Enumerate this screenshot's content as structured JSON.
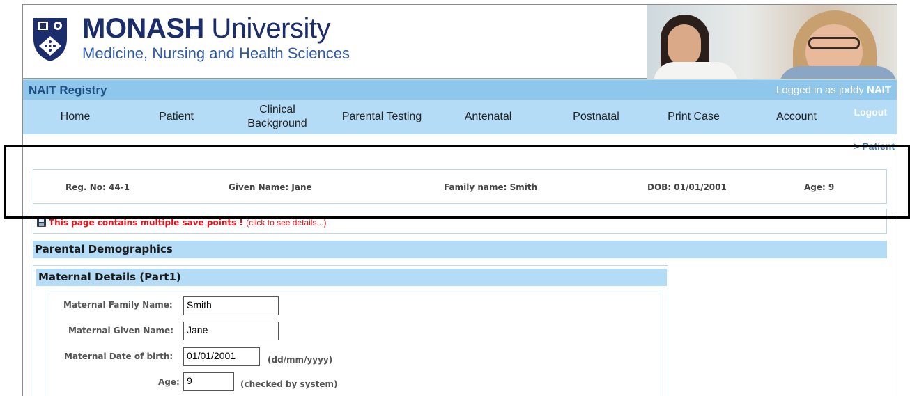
{
  "header": {
    "org_name_bold": "MONASH",
    "org_name_rest": " University",
    "faculty": "Medicine, Nursing and Health Sciences"
  },
  "registry": {
    "title": "NAIT Registry",
    "login_prefix": "Logged in as joddy ",
    "login_user": "NAIT"
  },
  "nav": {
    "home": "Home",
    "patient": "Patient",
    "clinical_line1": "Clinical",
    "clinical_line2": "Background",
    "parental_testing": "Parental Testing",
    "antenatal": "Antenatal",
    "postnatal": "Postnatal",
    "print_case": "Print Case",
    "account": "Account",
    "logout": "Logout"
  },
  "breadcrumb": "> Patient",
  "patient_info": {
    "reg_no": "Reg. No: 44-1",
    "given_name": "Given Name: Jane",
    "family_name": "Family name: Smith",
    "dob": "DOB: 01/01/2001",
    "age": "Age: 9"
  },
  "save_notice": {
    "message": "This page contains multiple save points ! ",
    "link": "(click to see details...)"
  },
  "section_title": "Parental Demographics",
  "maternal": {
    "heading": "Maternal Details (Part1)",
    "family_name_label": "Maternal Family Name:",
    "family_name_value": "Smith",
    "given_name_label": "Maternal Given Name:",
    "given_name_value": "Jane",
    "dob_label": "Maternal Date of birth:",
    "dob_value": "01/01/2001",
    "dob_hint": "(dd/mm/yyyy)",
    "age_label": "Age:",
    "age_value": "9",
    "age_hint": "(checked by system)"
  },
  "colors": {
    "nav_bg": "#b4dcf6",
    "registry_bar": "#8fc6ec",
    "brand_navy": "#1b2d6b",
    "warning_red": "#e8121b"
  }
}
